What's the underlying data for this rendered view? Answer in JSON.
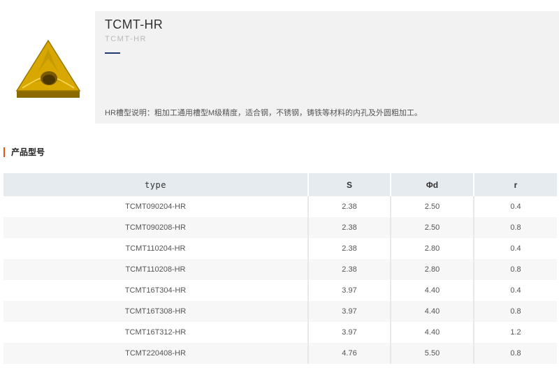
{
  "product": {
    "title": "TCMT-HR",
    "subtitle": "TCMT-HR",
    "description": "HR槽型说明：粗加工通用槽型M级精度，适合钢，不锈钢，铸铁等材料的内孔及外圆粗加工。",
    "image_icon": "triangular-insert-icon",
    "colors": {
      "insert_gold": "#d9a800",
      "accent_underline": "#1e3a6e"
    }
  },
  "section": {
    "heading": "产品型号",
    "accent_color": "#e8540f"
  },
  "table": {
    "headers": [
      "type",
      "S",
      "Φd",
      "r"
    ],
    "rows": [
      [
        "TCMT090204-HR",
        "2.38",
        "2.50",
        "0.4"
      ],
      [
        "TCMT090208-HR",
        "2.38",
        "2.50",
        "0.8"
      ],
      [
        "TCMT110204-HR",
        "2.38",
        "2.80",
        "0.4"
      ],
      [
        "TCMT110208-HR",
        "2.38",
        "2.80",
        "0.8"
      ],
      [
        "TCMT16T304-HR",
        "3.97",
        "4.40",
        "0.4"
      ],
      [
        "TCMT16T308-HR",
        "3.97",
        "4.40",
        "0.8"
      ],
      [
        "TCMT16T312-HR",
        "3.97",
        "4.40",
        "1.2"
      ],
      [
        "TCMT220408-HR",
        "4.76",
        "5.50",
        "0.8"
      ]
    ]
  }
}
